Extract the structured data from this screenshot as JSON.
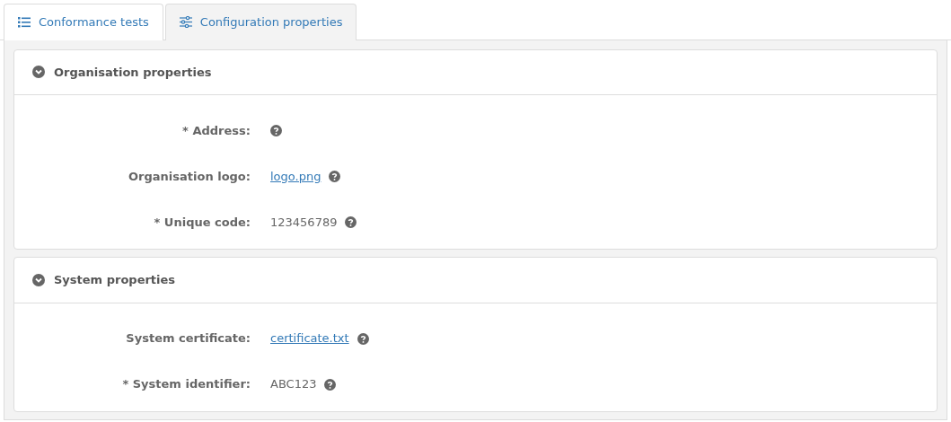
{
  "tabs": [
    {
      "label": "Conformance tests",
      "kind": "list",
      "selected": false
    },
    {
      "label": "Configuration properties",
      "kind": "sliders",
      "selected": true
    }
  ],
  "sections": [
    {
      "title": "Organisation properties",
      "expanded": true,
      "properties": [
        {
          "label": "* Address:",
          "kind": "empty"
        },
        {
          "label": "Organisation logo:",
          "kind": "link",
          "value": "logo.png"
        },
        {
          "label": "* Unique code:",
          "kind": "text",
          "value": "123456789"
        }
      ]
    },
    {
      "title": "System properties",
      "expanded": true,
      "properties": [
        {
          "label": "System certificate:",
          "kind": "link",
          "value": "certificate.txt"
        },
        {
          "label": "* System identifier:",
          "kind": "text",
          "value": "ABC123"
        }
      ]
    }
  ]
}
